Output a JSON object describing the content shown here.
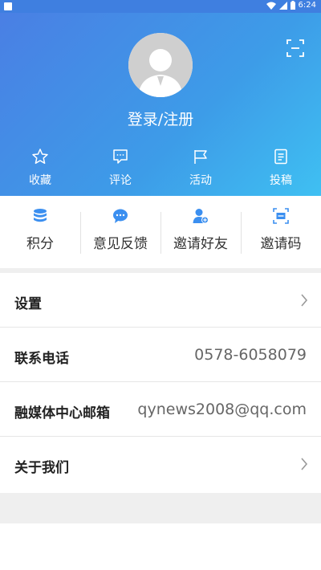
{
  "status_bar": {
    "time": "6:24"
  },
  "profile": {
    "login_label": "登录/注册"
  },
  "quick_actions": [
    {
      "label": "收藏",
      "icon": "star-icon"
    },
    {
      "label": "评论",
      "icon": "comment-icon"
    },
    {
      "label": "活动",
      "icon": "flag-icon"
    },
    {
      "label": "投稿",
      "icon": "document-icon"
    }
  ],
  "features": [
    {
      "label": "积分",
      "icon": "database-icon"
    },
    {
      "label": "意见反馈",
      "icon": "chat-bubble-icon"
    },
    {
      "label": "邀请好友",
      "icon": "add-user-icon"
    },
    {
      "label": "邀请码",
      "icon": "scan-code-icon"
    }
  ],
  "settings_list": [
    {
      "label": "设置",
      "value": "",
      "chevron": true
    },
    {
      "label": "联系电话",
      "value": "0578-6058079",
      "chevron": false
    },
    {
      "label": "融媒体中心邮箱",
      "value": "qynews2008@qq.com",
      "chevron": false
    },
    {
      "label": "关于我们",
      "value": "",
      "chevron": true
    }
  ],
  "colors": {
    "accent": "#3b8ff0",
    "header_start": "#4a7fe4",
    "header_end": "#3fc0f2"
  }
}
